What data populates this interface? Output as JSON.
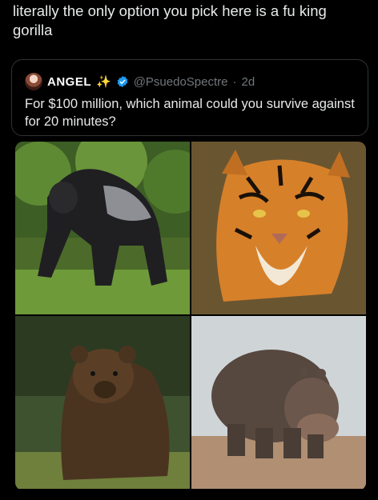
{
  "post": {
    "text": "literally the only option you pick here is a fu king gorilla"
  },
  "quoted_tweet": {
    "display_name": "ANGEL",
    "handle": "@PsuedoSpectre",
    "separator": "·",
    "time": "2d",
    "text": "For $100 million, which animal could you survive against for 20 minutes?",
    "images": [
      {
        "icon": "gorilla-photo"
      },
      {
        "icon": "tiger-photo"
      },
      {
        "icon": "bear-photo"
      },
      {
        "icon": "hippo-photo"
      }
    ]
  },
  "colors": {
    "background": "#000000",
    "text": "#e7e9ea",
    "muted": "#71767b",
    "verified": "#1d9bf0",
    "border": "#2f3336"
  }
}
